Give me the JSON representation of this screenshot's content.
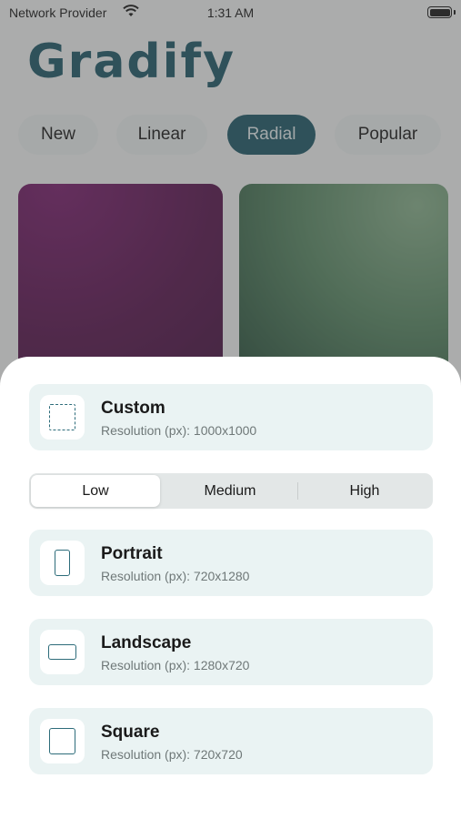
{
  "status_bar": {
    "carrier": "Network Provider",
    "time": "1:31 AM"
  },
  "app": {
    "title": "Gradify"
  },
  "tabs": [
    {
      "label": "New",
      "active": false
    },
    {
      "label": "Linear",
      "active": false
    },
    {
      "label": "Radial",
      "active": true
    },
    {
      "label": "Popular",
      "active": false
    }
  ],
  "colors": {
    "accent": "#1f5b6a",
    "option_bg": "#eaf3f3",
    "card_1": "#5a1650",
    "card_2": "#3a6a4e"
  },
  "sheet": {
    "custom": {
      "title": "Custom",
      "subtitle": "Resolution (px): 1000x1000",
      "icon": "dashed-square-icon"
    },
    "quality": {
      "options": [
        "Low",
        "Medium",
        "High"
      ],
      "selected": "Low"
    },
    "portrait": {
      "title": "Portrait",
      "subtitle": "Resolution (px): 720x1280",
      "icon": "portrait-rectangle-icon"
    },
    "landscape": {
      "title": "Landscape",
      "subtitle": "Resolution (px): 1280x720",
      "icon": "landscape-rectangle-icon"
    },
    "square": {
      "title": "Square",
      "subtitle": "Resolution (px): 720x720",
      "icon": "square-icon"
    }
  }
}
